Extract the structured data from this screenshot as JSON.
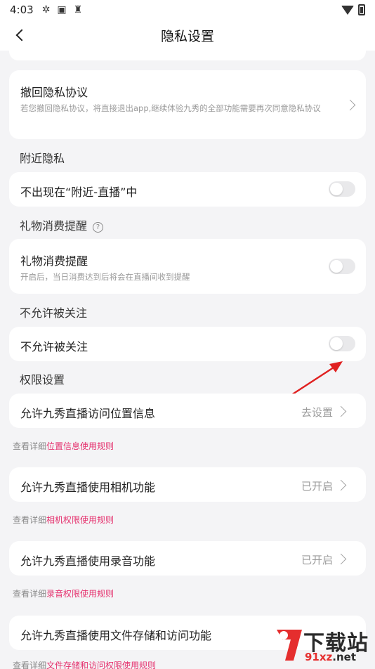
{
  "status_bar": {
    "time": "4:03",
    "icons": [
      "aperture-icon",
      "a-badge-icon",
      "broom-icon"
    ],
    "right_icons": [
      "wifi-icon",
      "battery-icon"
    ]
  },
  "nav": {
    "title": "隐私设置",
    "back_icon": "chevron-left-icon"
  },
  "withdraw": {
    "title": "撤回隐私协议",
    "desc": "若您撤回隐私协议，将直接退出app,继续体验九秀的全部功能需要再次同意隐私协议"
  },
  "nearby": {
    "section": "附近隐私",
    "item": "不出现在“附近-直播”中",
    "toggle_on": false
  },
  "gift": {
    "section": "礼物消费提醒",
    "item": "礼物消费提醒",
    "desc": "开启后，当日消费达到后将会在直播间收到提醒",
    "toggle_on": false
  },
  "follow": {
    "section": "不允许被关注",
    "item": "不允许被关注",
    "toggle_on": false
  },
  "permissions": {
    "section": "权限设置",
    "items": [
      {
        "label": "允许九秀直播访问位置信息",
        "status": "去设置",
        "note_prefix": "查看详细",
        "note_link": "位置信息使用规则"
      },
      {
        "label": "允许九秀直播使用相机功能",
        "status": "已开启",
        "note_prefix": "查看详细",
        "note_link": "相机权限使用规则"
      },
      {
        "label": "允许九秀直播使用录音功能",
        "status": "已开启",
        "note_prefix": "查看详细",
        "note_link": "录音权限使用规则"
      },
      {
        "label": "允许九秀直播使用文件存储和访问功能",
        "status": "",
        "note_prefix": "查看详细",
        "note_link": "文件存储和访问权限使用规则"
      }
    ]
  },
  "watermark": {
    "brand": "下载站",
    "url_a": "91xz",
    "url_b": ".net"
  },
  "colors": {
    "link": "#e5306d",
    "arrow": "#e02020",
    "background": "#f4f4f6"
  }
}
